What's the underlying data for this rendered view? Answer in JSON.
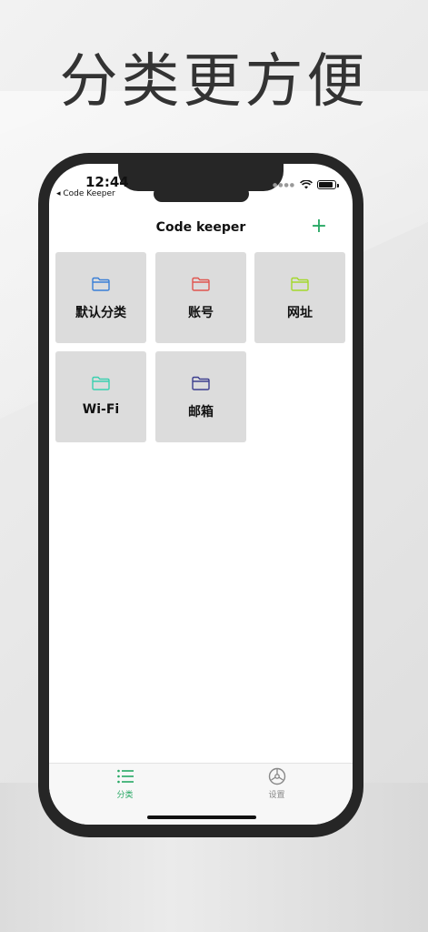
{
  "promo": {
    "headline": "分类更方便"
  },
  "status_bar": {
    "time": "12:44",
    "back_app": "◂ Code Keeper"
  },
  "nav": {
    "title": "Code keeper",
    "add_label": "+"
  },
  "colors": {
    "accent": "#27a864",
    "tile_bg": "#dcdcdc",
    "inactive": "#888888"
  },
  "categories": [
    {
      "label": "默认分类",
      "icon": "folder-icon",
      "color": "#3a7fd6"
    },
    {
      "label": "账号",
      "icon": "folder-icon",
      "color": "#e0554f"
    },
    {
      "label": "网址",
      "icon": "folder-icon",
      "color": "#a3d82c"
    },
    {
      "label": "Wi-Fi",
      "icon": "folder-icon",
      "color": "#3bd0b0"
    },
    {
      "label": "邮箱",
      "icon": "folder-icon",
      "color": "#3d3f8f"
    }
  ],
  "tabbar": {
    "tabs": [
      {
        "label": "分类",
        "icon": "list-icon",
        "active": true
      },
      {
        "label": "设置",
        "icon": "settings-icon",
        "active": false
      }
    ]
  }
}
